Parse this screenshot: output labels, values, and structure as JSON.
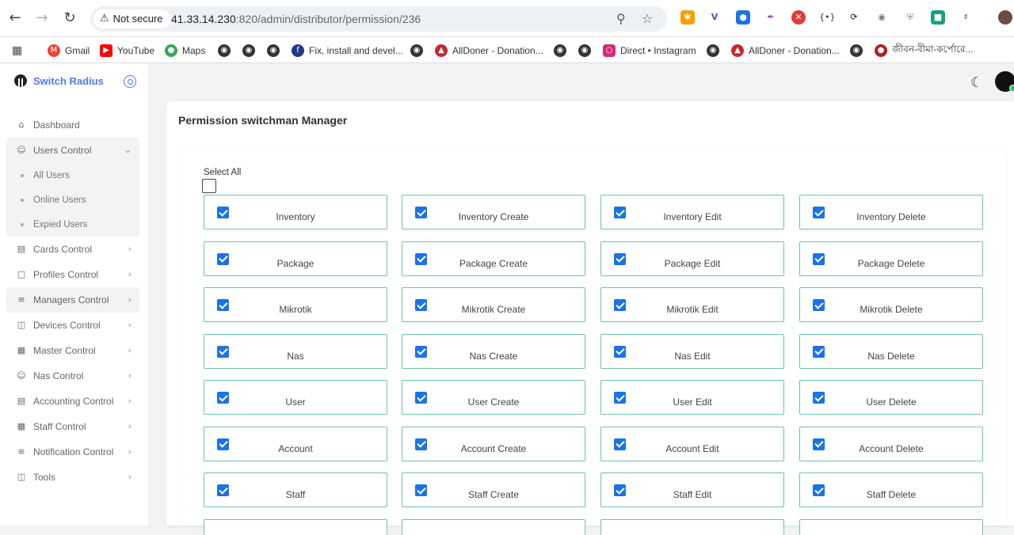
{
  "browser": {
    "security_label": "Not secure",
    "url_host": "41.33.14.230",
    "url_path": ":820/admin/distributor/permission/236"
  },
  "bookmarks": [
    {
      "label": "Gmail",
      "icon": "gmail-icon",
      "color": "#ea4335"
    },
    {
      "label": "YouTube",
      "icon": "youtube-icon",
      "color": "#ff0000"
    },
    {
      "label": "Maps",
      "icon": "maps-icon",
      "color": "#34a853"
    },
    {
      "label": "Fix, install and devel...",
      "icon": "site-icon",
      "color": "#1e3a8a"
    },
    {
      "label": "AllDoner - Donation...",
      "icon": "site-icon",
      "color": "#c62828"
    },
    {
      "label": "Direct • Instagram",
      "icon": "instagram-icon",
      "color": "#d62976"
    },
    {
      "label": "AllDoner - Donation...",
      "icon": "site-icon",
      "color": "#c62828"
    },
    {
      "label": "জীবন-বীমা-কর্পোরে...",
      "icon": "site-icon",
      "color": "#b71c1c"
    }
  ],
  "sidebar": {
    "brand": "Switch Radius",
    "items": [
      {
        "label": "Dashboard",
        "icon": "home-icon",
        "has_chevron": false
      },
      {
        "label": "Users Control",
        "icon": "user-icon",
        "has_chevron": true,
        "open": true,
        "children": [
          "All Users",
          "Online Users",
          "Expied Users"
        ]
      },
      {
        "label": "Cards Control",
        "icon": "card-icon",
        "has_chevron": true
      },
      {
        "label": "Profiles Control",
        "icon": "profile-icon",
        "has_chevron": true
      },
      {
        "label": "Managers Control",
        "icon": "manager-icon",
        "has_chevron": true
      },
      {
        "label": "Devices Control",
        "icon": "device-icon",
        "has_chevron": true
      },
      {
        "label": "Master Control",
        "icon": "master-icon",
        "has_chevron": true
      },
      {
        "label": "Nas Control",
        "icon": "user-icon",
        "has_chevron": true
      },
      {
        "label": "Accounting Control",
        "icon": "accounting-icon",
        "has_chevron": true
      },
      {
        "label": "Staff Control",
        "icon": "staff-icon",
        "has_chevron": true
      },
      {
        "label": "Notification Control",
        "icon": "notification-icon",
        "has_chevron": true
      },
      {
        "label": "Tools",
        "icon": "tools-icon",
        "has_chevron": true
      }
    ]
  },
  "page": {
    "title": "Permission switchman Manager",
    "select_all_label": "Select All",
    "select_all_checked": false
  },
  "permissions": [
    [
      "Inventory",
      "Inventory Create",
      "Inventory Edit",
      "Inventory Delete"
    ],
    [
      "Package",
      "Package Create",
      "Package Edit",
      "Package Delete"
    ],
    [
      "Mikrotik",
      "Mikrotik Create",
      "Mikrotik Edit",
      "Mikrotik Delete"
    ],
    [
      "Nas",
      "Nas Create",
      "Nas Edit",
      "Nas Delete"
    ],
    [
      "User",
      "User Create",
      "User Edit",
      "User Delete"
    ],
    [
      "Account",
      "Account Create",
      "Account Edit",
      "Account Delete"
    ],
    [
      "Staff",
      "Staff Create",
      "Staff Edit",
      "Staff Delete"
    ]
  ],
  "colors": {
    "accent": "#4d79f6",
    "checkbox": "#1a73e8",
    "card_border": "#6dc6a3"
  }
}
